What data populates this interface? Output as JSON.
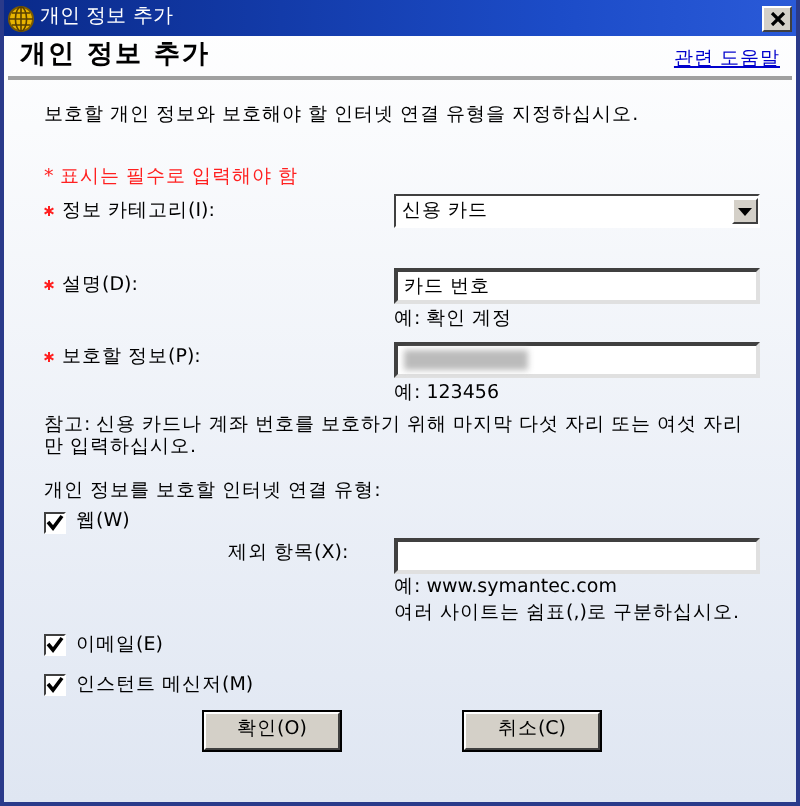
{
  "window": {
    "title": "개인 정보 추가"
  },
  "header": {
    "title": "개인 정보 추가",
    "help_link": "관련 도움말"
  },
  "intro": "보호할 개인 정보와 보호해야 할 인터넷 연결 유형을 지정하십시오.",
  "required_note": "* 표시는 필수로 입력해야 함",
  "fields": [
    {
      "kind": "dropdown",
      "required": true,
      "label": "정보 카테고리(I):",
      "value": "신용 카드"
    },
    {
      "kind": "text",
      "required": true,
      "label": "설명(D):",
      "value": "카드 번호",
      "hint": "예: 확인 계정"
    },
    {
      "kind": "masked",
      "required": true,
      "label": "보호할 정보(P):",
      "hint": "예: 123456"
    }
  ],
  "note": "참고: 신용 카드나 계좌 번호를 보호하기 위해 마지막 다섯 자리 또는 여섯 자리만 입력하십시오.",
  "connection_heading": "개인 정보를 보호할 인터넷 연결 유형:",
  "connections": [
    {
      "label": "웹(W)",
      "checked": true,
      "exclusion": {
        "label": "제외 항목(X):",
        "hints": [
          "예: www.symantec.com",
          "여러 사이트는 쉼표(,)로 구분하십시오."
        ]
      }
    },
    {
      "label": "이메일(E)",
      "checked": true
    },
    {
      "label": "인스턴트 메신저(M)",
      "checked": true
    }
  ],
  "buttons": [
    "확인(O)",
    "취소(C)"
  ]
}
